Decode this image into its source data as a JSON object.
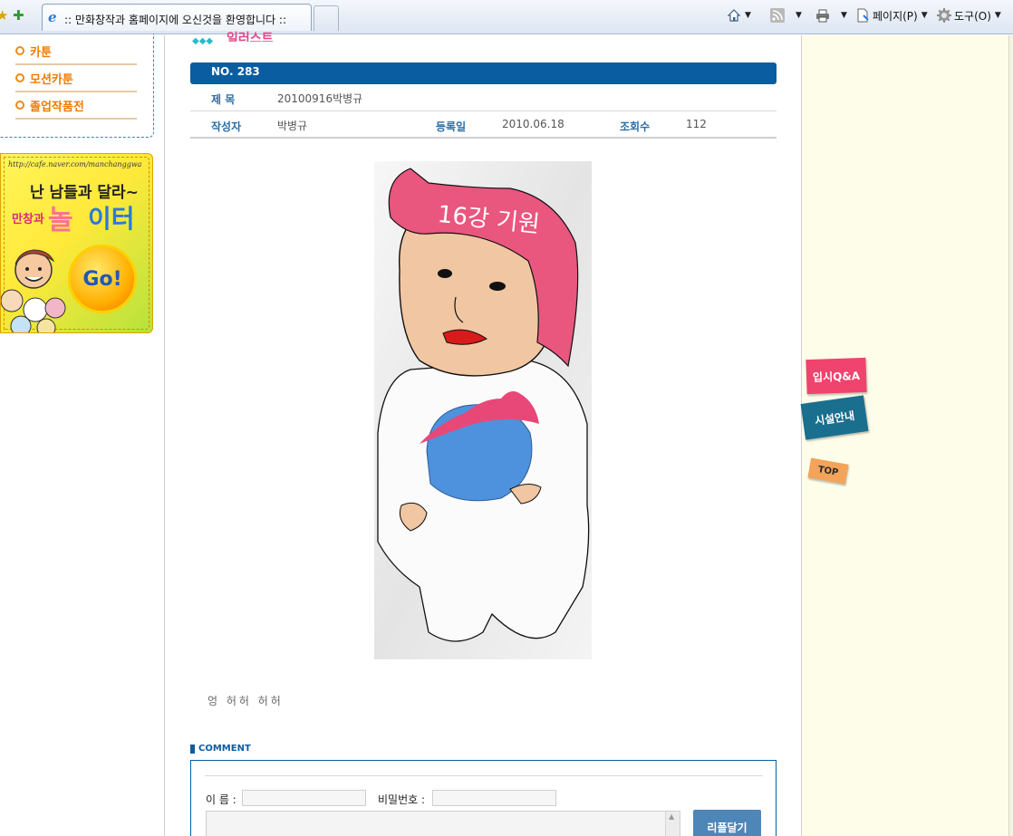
{
  "browser": {
    "tab_title": ":: 만화창작과 홈페이지에 오신것을 환영합니다 ::",
    "page_menu": "페이지(P)",
    "tools_menu": "도구(O)"
  },
  "sidebar": {
    "menu_items": [
      {
        "label": "카툰"
      },
      {
        "label": "모션카툰"
      },
      {
        "label": "졸업작품전"
      }
    ],
    "banner": {
      "url": "http://cafe.naver.com/manchanggwa",
      "line1": "난 남들과 달라~",
      "line2_small": "만창과",
      "line2_big_a": "놀",
      "line2_big_b": "이터",
      "go": "Go!"
    }
  },
  "post": {
    "number": "NO. 283",
    "title_label": "제  목",
    "title": "20100916박병규",
    "author_label": "작성자",
    "author": "박병규",
    "date_label": "등록일",
    "date": "2010.06.18",
    "views_label": "조회수",
    "views": "112",
    "body": "엉 허허 허허",
    "artwork_text": "16강 기원"
  },
  "comment": {
    "heading": "COMMENT",
    "name_label": "이 름 :",
    "password_label": "비밀번호 :",
    "submit_label": "리플달기"
  },
  "quick_links": {
    "qna": "입시Q&A",
    "facilities": "시설안내",
    "top": "TOP"
  },
  "colors": {
    "accent": "#0a5da0",
    "menu_orange": "#f07a00",
    "right_bg": "#fdfdea"
  }
}
